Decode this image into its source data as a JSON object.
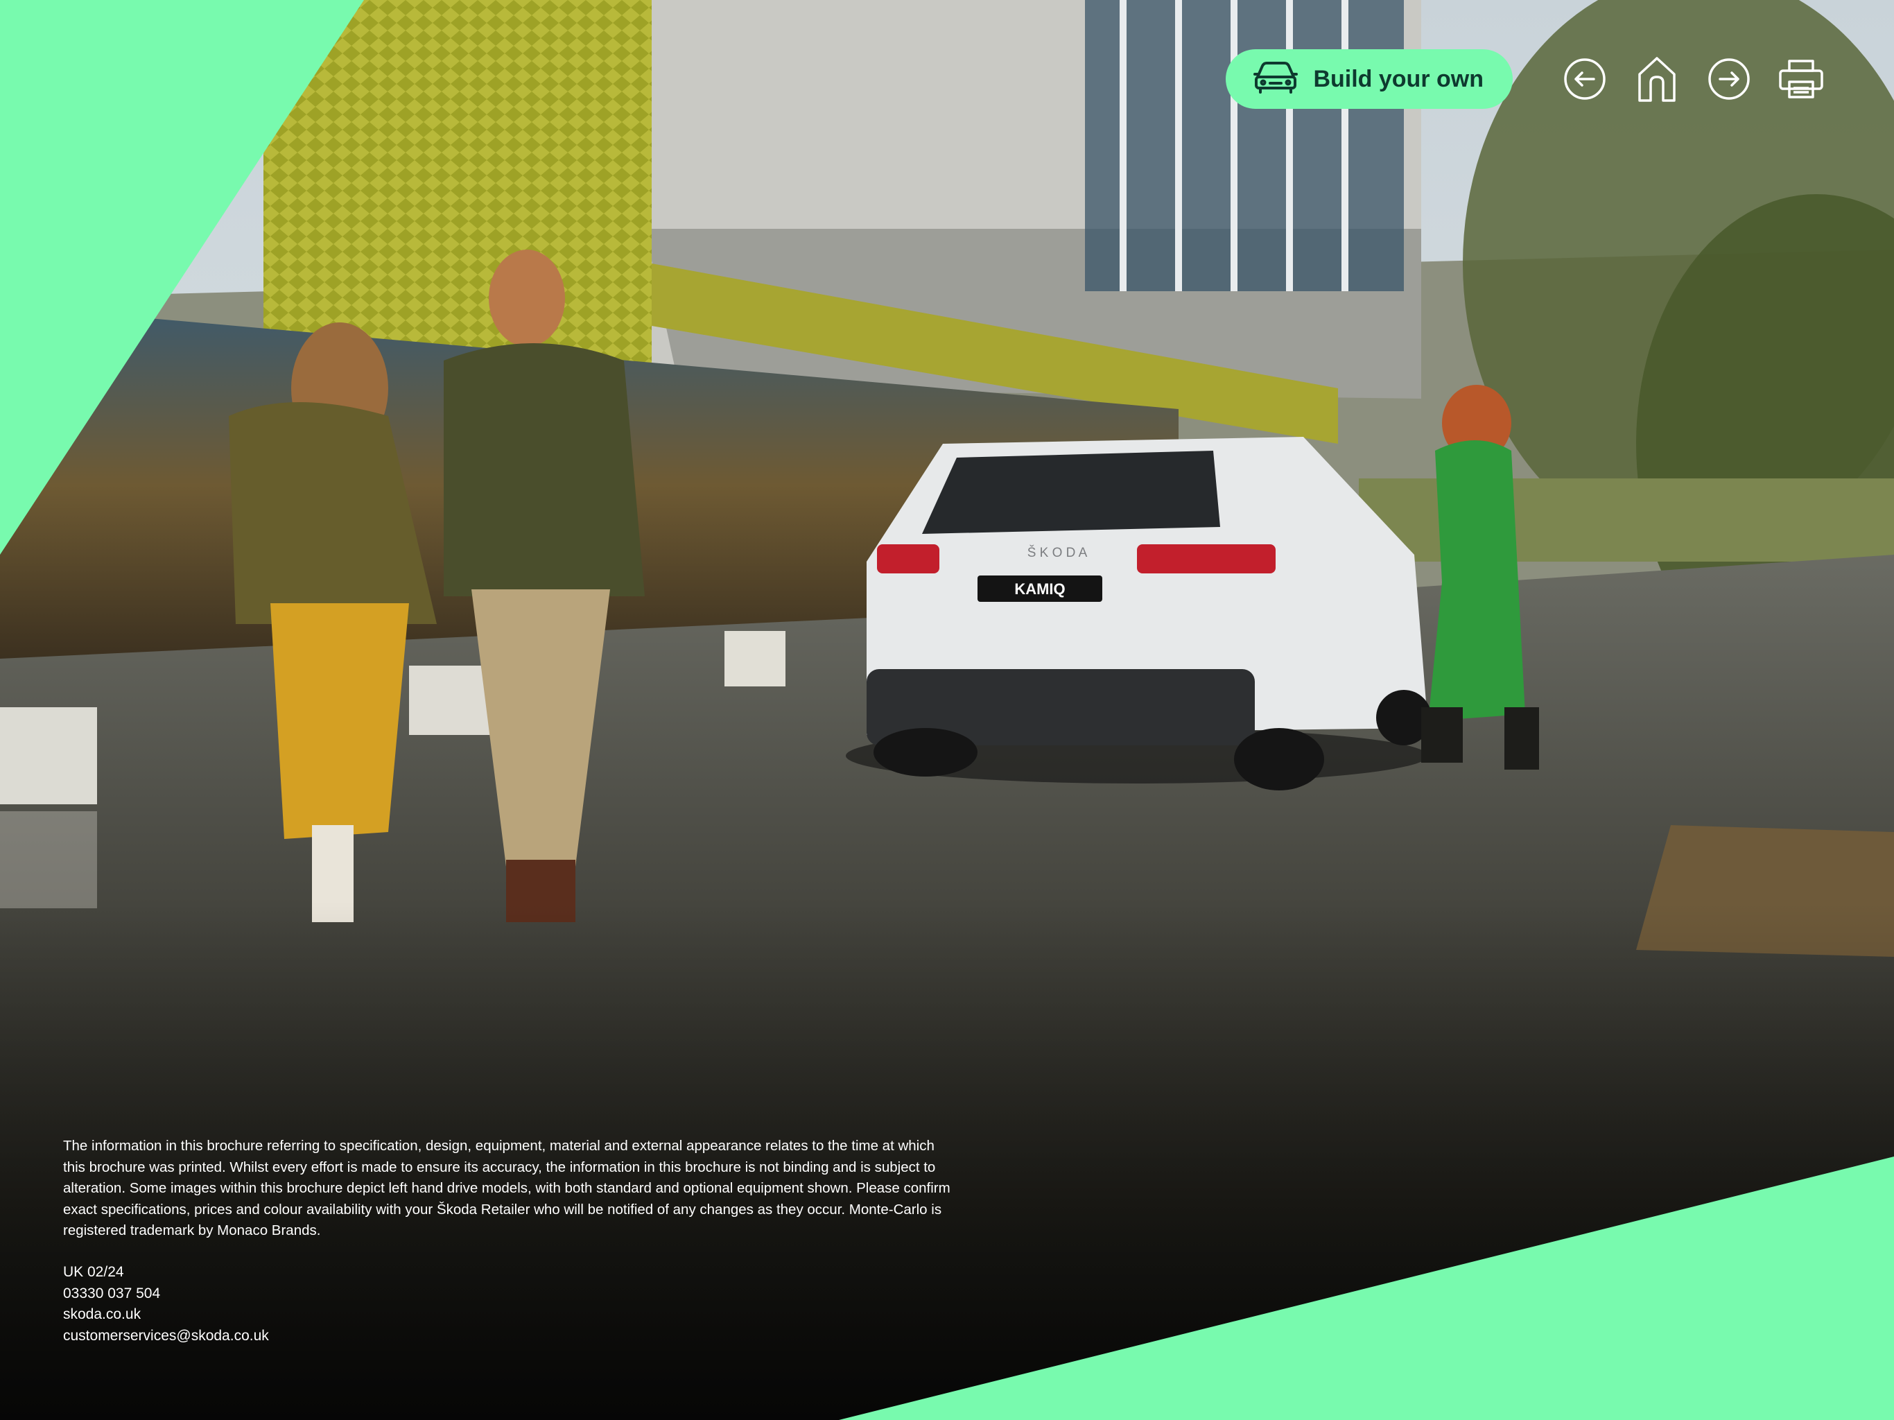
{
  "colors": {
    "brand_green": "#78faae",
    "button_text": "#0e3a2f",
    "icon_white": "#ffffff",
    "footer_text": "#ffffff"
  },
  "hero": {
    "vehicle_badge": "KAMIQ",
    "rear_lettering": "Š K O D A"
  },
  "toolbar": {
    "build_icon": "car-icon",
    "build_label": "Build your own",
    "back_icon": "arrow-left-circle-icon",
    "home_icon": "home-icon",
    "forward_icon": "arrow-right-circle-icon",
    "print_icon": "printer-icon"
  },
  "footer": {
    "disclaimer": "The information in this brochure referring to specification, design, equipment, material and external appearance relates to the time at which this brochure was printed. Whilst every effort is made to ensure its accuracy, the information in this brochure is not binding and is subject to alteration. Some images within this brochure depict left hand drive models, with both standard and optional equipment shown. Please confirm exact specifications, prices and colour availability with your Škoda Retailer who will be notified of any changes as they occur. Monte-Carlo is registered trademark by Monaco Brands.",
    "edition": "UK 02/24",
    "phone": "03330 037 504",
    "website": "skoda.co.uk",
    "email": "customerservices@skoda.co.uk"
  }
}
